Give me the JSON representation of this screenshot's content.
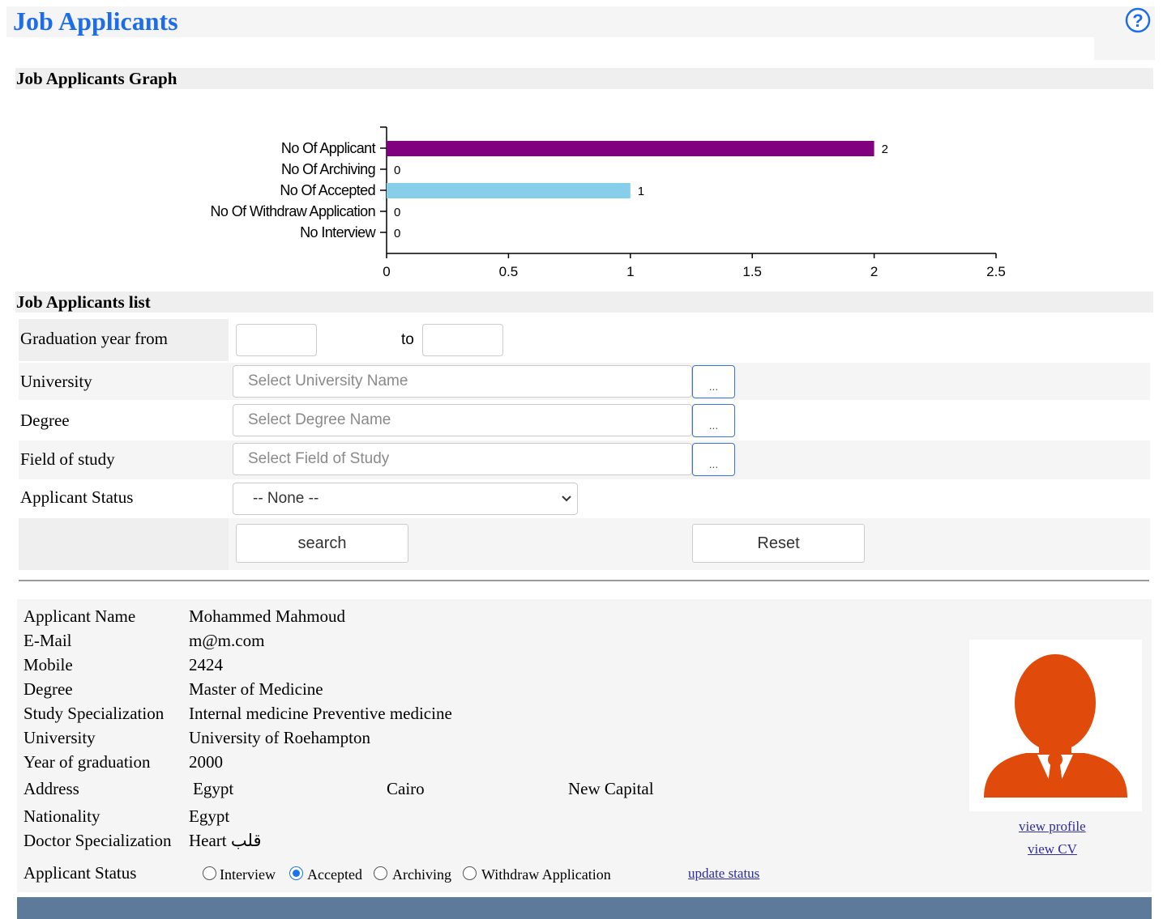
{
  "page": {
    "title": "Job Applicants"
  },
  "graph_section": {
    "title": "Job Applicants Graph"
  },
  "chart_data": {
    "type": "bar",
    "orientation": "horizontal",
    "categories": [
      "No Of Applicant",
      "No Of Archiving",
      "No Of Accepted",
      "No Of Withdraw Application",
      "No Interview"
    ],
    "values": [
      2,
      0,
      1,
      0,
      0
    ],
    "value_labels": [
      "2",
      "0",
      "1",
      "0",
      "0"
    ],
    "colors": [
      "#800080",
      "#800080",
      "#87ceeb",
      "#87ceeb",
      "#87ceeb"
    ],
    "xlim": [
      0,
      2.5
    ],
    "xticks": [
      0,
      0.5,
      1,
      1.5,
      2,
      2.5
    ],
    "xtick_labels": [
      "0",
      "0.5",
      "1",
      "1.5",
      "2",
      "2.5"
    ]
  },
  "list_section": {
    "title": "Job Applicants list"
  },
  "filters": {
    "grad_from_label": "Graduation year from",
    "grad_to_label": "to",
    "university_label": "University",
    "university_placeholder": "Select University Name",
    "degree_label": "Degree",
    "degree_placeholder": "Select Degree Name",
    "field_label": "Field of study",
    "field_placeholder": "Select Field of Study",
    "browse_label": "...",
    "status_label": "Applicant Status",
    "status_selected": "-- None --",
    "search_label": "search",
    "reset_label": "Reset"
  },
  "applicant": {
    "name_label": "Applicant Name",
    "name": "Mohammed Mahmoud",
    "email_label": "E-Mail",
    "email": "m@m.com",
    "mobile_label": "Mobile",
    "mobile": "2424",
    "degree_label": "Degree",
    "degree": "Master of Medicine",
    "spec_label": "Study Specialization",
    "spec": "Internal medicine Preventive medicine",
    "univ_label": "University",
    "univ": "University of Roehampton",
    "year_label": "Year of graduation",
    "year": "2000",
    "address_label": "Address",
    "country": "Egypt",
    "city": "Cairo",
    "district": "New Capital",
    "nationality_label": "Nationality",
    "nationality": "Egypt",
    "doctor_spec_label": "Doctor Specialization",
    "doctor_spec": "Heart قلب",
    "status_label": "Applicant Status",
    "status_options": [
      "Interview",
      "Accepted",
      "Archiving",
      "Withdraw Application"
    ],
    "status_selected": "Accepted",
    "update_link": "update status",
    "view_profile": "view profile",
    "view_cv": "view CV",
    "avatar_color": "#e04a0a"
  }
}
